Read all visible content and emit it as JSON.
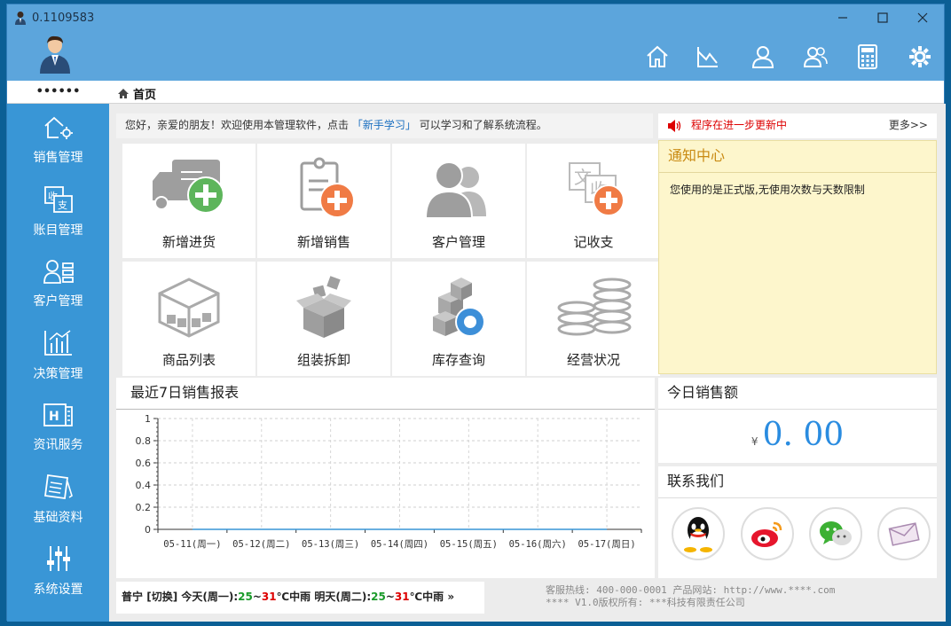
{
  "window": {
    "title": "0.1109583"
  },
  "user": {
    "masked_name": "••••••"
  },
  "breadcrumb": {
    "home": "首页"
  },
  "sidebar": {
    "items": [
      {
        "label": "销售管理",
        "icon": "home-gear-icon"
      },
      {
        "label": "账目管理",
        "icon": "receipt-icon"
      },
      {
        "label": "客户管理",
        "icon": "customer-list-icon"
      },
      {
        "label": "决策管理",
        "icon": "bar-chart-icon"
      },
      {
        "label": "资讯服务",
        "icon": "news-icon"
      },
      {
        "label": "基础资料",
        "icon": "notebook-icon"
      },
      {
        "label": "系统设置",
        "icon": "sliders-icon"
      }
    ]
  },
  "welcome": {
    "prefix": "您好，亲爱的朋友！欢迎使用本管理软件，点击",
    "link": "「新手学习」",
    "suffix": " 可以学习和了解系统流程。"
  },
  "update": {
    "text": "程序在进一步更新中",
    "more": "更多>>"
  },
  "tiles": [
    {
      "label": "新增进货"
    },
    {
      "label": "新增销售"
    },
    {
      "label": "客户管理"
    },
    {
      "label": "记收支"
    },
    {
      "label": "商品列表"
    },
    {
      "label": "组装拆卸"
    },
    {
      "label": "库存查询"
    },
    {
      "label": "经营状况"
    }
  ],
  "notice": {
    "title": "通知中心",
    "message": "您使用的是正式版,无使用次数与天数限制"
  },
  "report": {
    "title": "最近7日销售报表"
  },
  "chart_data": {
    "type": "line",
    "categories": [
      "05-11(周一)",
      "05-12(周二)",
      "05-13(周三)",
      "05-14(周四)",
      "05-15(周五)",
      "05-16(周六)",
      "05-17(周日)"
    ],
    "values": [
      0,
      0,
      0,
      0,
      0,
      0,
      0
    ],
    "ylim": [
      0,
      1
    ],
    "yticks": [
      "0",
      "0.2",
      "0.4",
      "0.6",
      "0.8",
      "1"
    ],
    "grid": true
  },
  "sales": {
    "title": "今日销售额",
    "currency": "¥",
    "amount": "0. 00"
  },
  "contact": {
    "title": "联系我们",
    "icons": [
      "qq-icon",
      "weibo-icon",
      "wechat-icon",
      "mail-icon"
    ]
  },
  "weather": {
    "city": "普宁",
    "switch": "[切换]",
    "today_label": "今天(周一):",
    "today_low": "25",
    "today_high": "31",
    "today_desc": "℃中雨",
    "tomorrow_label": "明天(周二):",
    "tomorrow_low": "25",
    "tomorrow_high": "31",
    "tomorrow_desc": "℃中雨",
    "sep": "~",
    "arrow": "»"
  },
  "footer": {
    "line1": "客服热线: 400-000-0001  产品网站: http://www.****.com",
    "line2": "**** V1.0版权所有: ***科技有限责任公司"
  },
  "colors": {
    "accent": "#3996d6",
    "header": "#5ca5dc",
    "amount": "#2a8ce0",
    "notice_bg": "#fdf6cc"
  }
}
